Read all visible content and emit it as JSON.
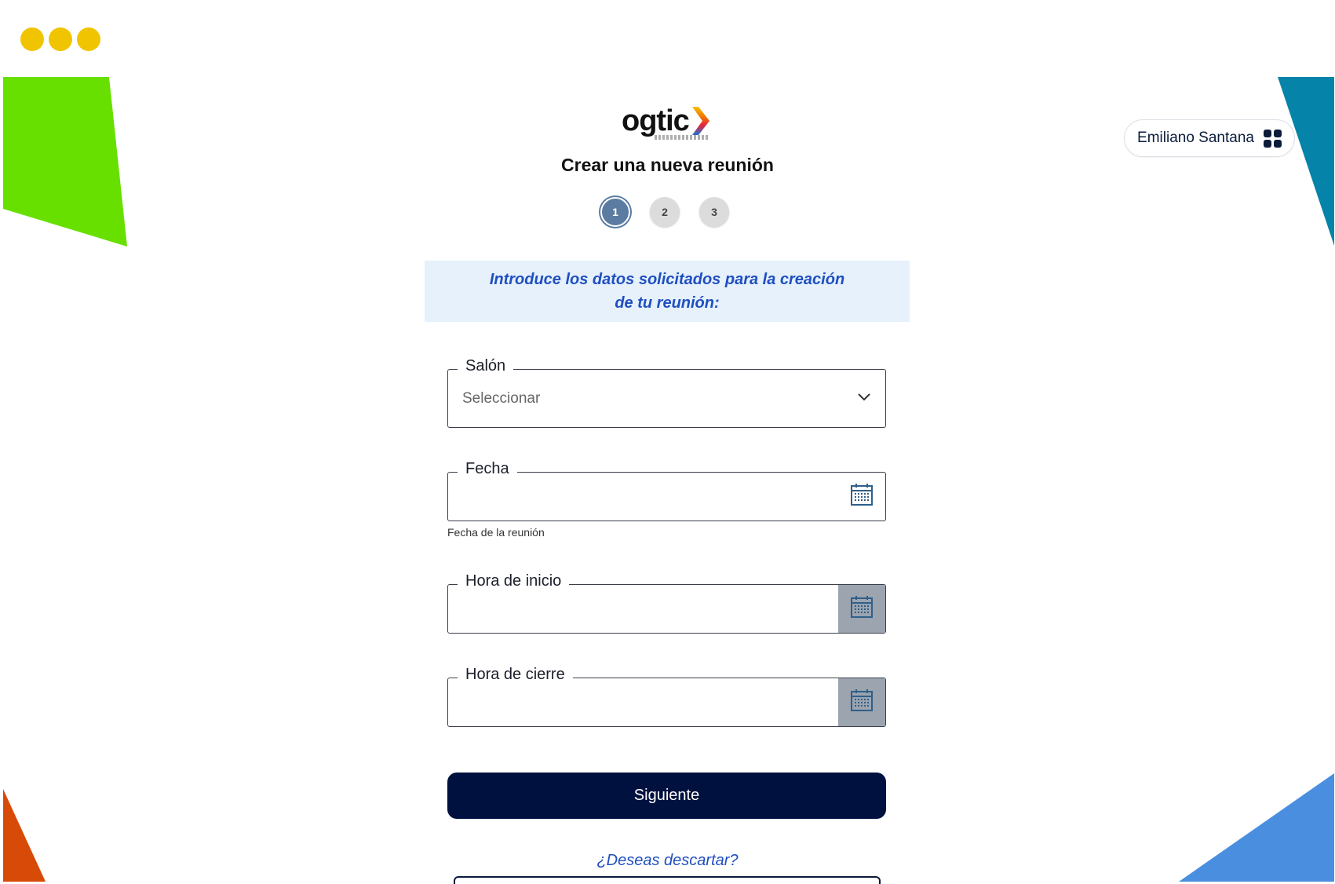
{
  "user": {
    "name": "Emiliano Santana"
  },
  "logo": {
    "text": "ogtic"
  },
  "page": {
    "title": "Crear una nueva reunión",
    "instruction": "Introduce los datos solicitados para la creación de tu reunión:"
  },
  "stepper": {
    "steps": [
      "1",
      "2",
      "3"
    ],
    "active": 1
  },
  "form": {
    "salon": {
      "label": "Salón",
      "value": "Seleccionar"
    },
    "fecha": {
      "label": "Fecha",
      "helper": "Fecha de la reunión"
    },
    "hora_inicio": {
      "label": "Hora de inicio"
    },
    "hora_cierre": {
      "label": "Hora de cierre"
    }
  },
  "actions": {
    "next": "Siguiente",
    "discard": "¿Deseas descartar?"
  },
  "colors": {
    "primary": "#001140",
    "link": "#1f4fbf",
    "info_bg": "#e6f1fc",
    "step_active": "#5b7ba0",
    "dots": "#f0c400",
    "deco_green": "#67e000",
    "deco_teal": "#0583a8",
    "deco_orange": "#d84a07",
    "deco_blue": "#4a8ee0"
  },
  "icons": {
    "apps": "apps-grid-icon",
    "dropdown": "chevron-down-icon",
    "calendar": "calendar-icon"
  }
}
